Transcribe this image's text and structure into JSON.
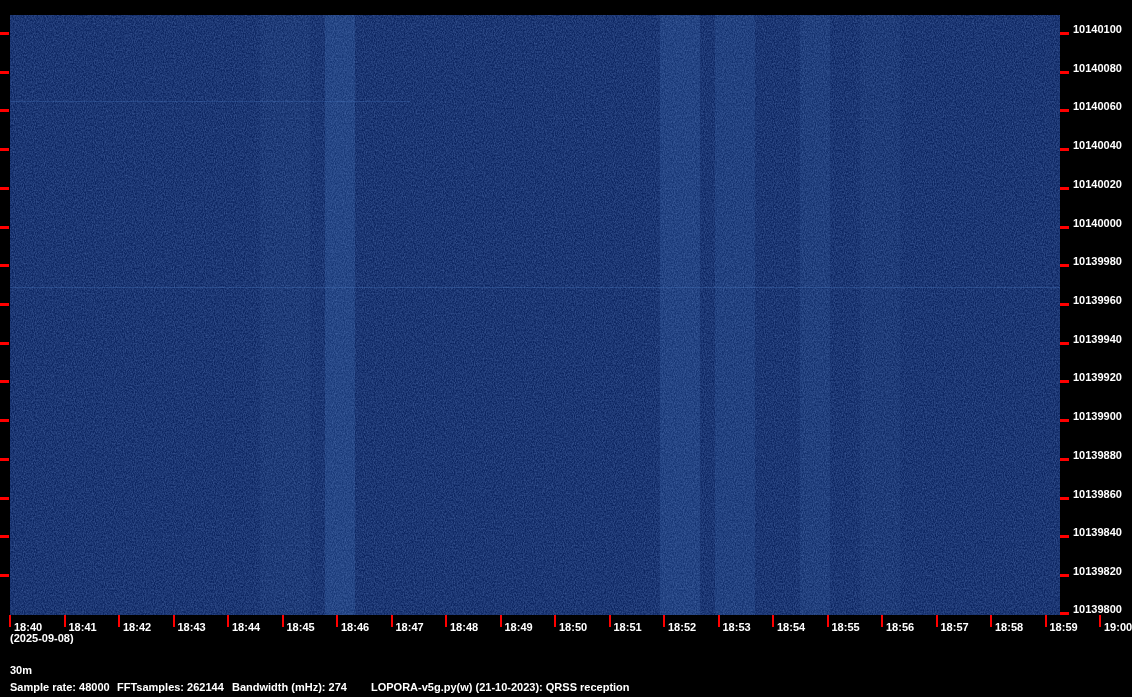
{
  "frequency_axis": {
    "labels": [
      "10140100",
      "10140080",
      "10140060",
      "10140040",
      "10140020",
      "10140000",
      "10139980",
      "10139960",
      "10139940",
      "10139920",
      "10139900",
      "10139880",
      "10139860",
      "10139840",
      "10139820",
      "10139800"
    ]
  },
  "time_axis": {
    "labels": [
      "18:40",
      "18:41",
      "18:42",
      "18:43",
      "18:44",
      "18:45",
      "18:46",
      "18:47",
      "18:48",
      "18:49",
      "18:50",
      "18:51",
      "18:52",
      "18:53",
      "18:54",
      "18:55",
      "18:56",
      "18:57",
      "18:58",
      "18:59",
      "19:00"
    ]
  },
  "date": "(2025-09-08)",
  "band": "30m",
  "info": [
    "Sample rate: 48000",
    "FFTsamples: 262144",
    "Bandwidth (mHz): 274",
    "LOPORA-v5g.py(w) (21-10-2023): QRSS reception"
  ]
}
